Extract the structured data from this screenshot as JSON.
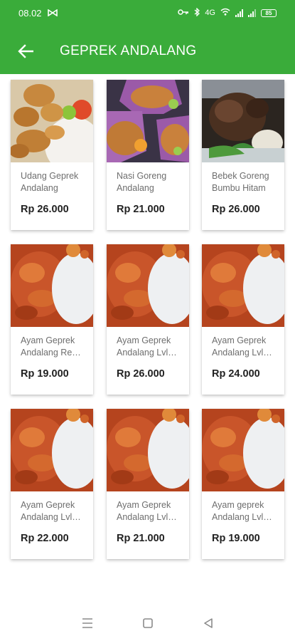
{
  "status_bar": {
    "time": "08.02",
    "network_label": "4G",
    "battery": "85"
  },
  "toolbar": {
    "title": "GEPREK ANDALANG",
    "back_icon": "arrow-left-icon"
  },
  "colors": {
    "primary": "#3aac3a",
    "card_bg": "#ffffff",
    "name_text": "#6e6e6e",
    "price_text": "#222222"
  },
  "products": [
    {
      "name": "Udang Geprek Andalang",
      "price": "Rp 26.000",
      "image": "fried-shrimp-rice"
    },
    {
      "name": "Nasi Goreng Andalang",
      "price": "Rp 21.000",
      "image": "fried-rice"
    },
    {
      "name": "Bebek Goreng Bumbu Hitam",
      "price": "Rp 26.000",
      "image": "fried-duck"
    },
    {
      "name": "Ayam Geprek Andalang Re…",
      "price": "Rp 19.000",
      "image": "geprek-chicken"
    },
    {
      "name": "Ayam Geprek Andalang Lvl…",
      "price": "Rp 26.000",
      "image": "geprek-chicken"
    },
    {
      "name": "Ayam Geprek Andalang Lvl…",
      "price": "Rp 24.000",
      "image": "geprek-chicken"
    },
    {
      "name": "Ayam Geprek Andalang Lvl…",
      "price": "Rp 22.000",
      "image": "geprek-chicken"
    },
    {
      "name": "Ayam Geprek Andalang Lvl…",
      "price": "Rp 21.000",
      "image": "geprek-chicken"
    },
    {
      "name": "Ayam geprek Andalang Lvl…",
      "price": "Rp 19.000",
      "image": "geprek-chicken"
    }
  ],
  "nav_bar": {
    "recents_icon": "menu-lines-icon",
    "home_icon": "square-home-icon",
    "back_icon": "triangle-back-icon"
  }
}
